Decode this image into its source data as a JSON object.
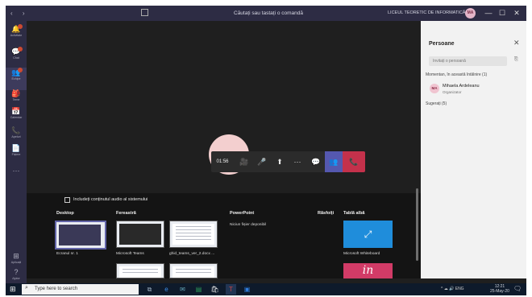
{
  "titlebar": {
    "nav": "‹ ›",
    "title": "Căutați sau tastați o comandă",
    "org": "LICEUL TEORETIC DE INFORMATICĂ \"G...",
    "avatar": "MA",
    "min": "—",
    "max": "☐",
    "close": "✕"
  },
  "rail": [
    {
      "icon": "🔔",
      "label": "Activitate",
      "badge": true
    },
    {
      "icon": "💬",
      "label": "Chat",
      "badge": true
    },
    {
      "icon": "👥",
      "label": "Echipe",
      "badge": true,
      "active": true
    },
    {
      "icon": "🎒",
      "label": "Teme",
      "badge": false
    },
    {
      "icon": "📅",
      "label": "Calendar",
      "badge": false
    },
    {
      "icon": "📞",
      "label": "Apeluri",
      "badge": false
    },
    {
      "icon": "📄",
      "label": "Fișiere",
      "badge": false
    },
    {
      "icon": "···",
      "label": "",
      "badge": false
    },
    {
      "icon": "⊞",
      "label": "Aplicații",
      "badge": false
    },
    {
      "icon": "?",
      "label": "Ajutor",
      "badge": false
    }
  ],
  "controls": {
    "timer": "01:56",
    "camera": "🎥",
    "mic": "🎤",
    "share": "⬆",
    "more": "···",
    "chat": "💬",
    "people": "👥",
    "hangup": "📞"
  },
  "tray": {
    "include_audio": "Includeți conținutul audio al sistemului",
    "sections": {
      "desktop": "Desktop",
      "window": "Fereastră",
      "powerpoint": "PowerPoint",
      "browse": "Răsfoiți",
      "whiteboard": "Tablă albă"
    },
    "desktop_item": "Ecranul nr. 1",
    "window_items": [
      "Microsoft Teams",
      "ghid_teams_ver_2.docx ..."
    ],
    "powerpoint_empty": "Niciun fișier deponibil",
    "whiteboard_item": "Microsoft Whiteboard",
    "whiteboard_icon": "⤢",
    "whiteboard2_icon": "in"
  },
  "panel": {
    "title": "Persoane",
    "close": "✕",
    "invite_placeholder": "Invitați o persoană",
    "group_current": "Momentan, în această întâlnire (1)",
    "person_initials": "MA",
    "person_name": "Mihaela Ardeleanu",
    "person_role": "Organizator",
    "group_suggested": "Sugerați (5)"
  },
  "taskbar": {
    "start": "⊞",
    "search_placeholder": "Type here to search",
    "tray_icons": "^ ☁ 🔊 ENG",
    "time": "12:21",
    "date": "25-May-20",
    "notif": "🗨"
  }
}
